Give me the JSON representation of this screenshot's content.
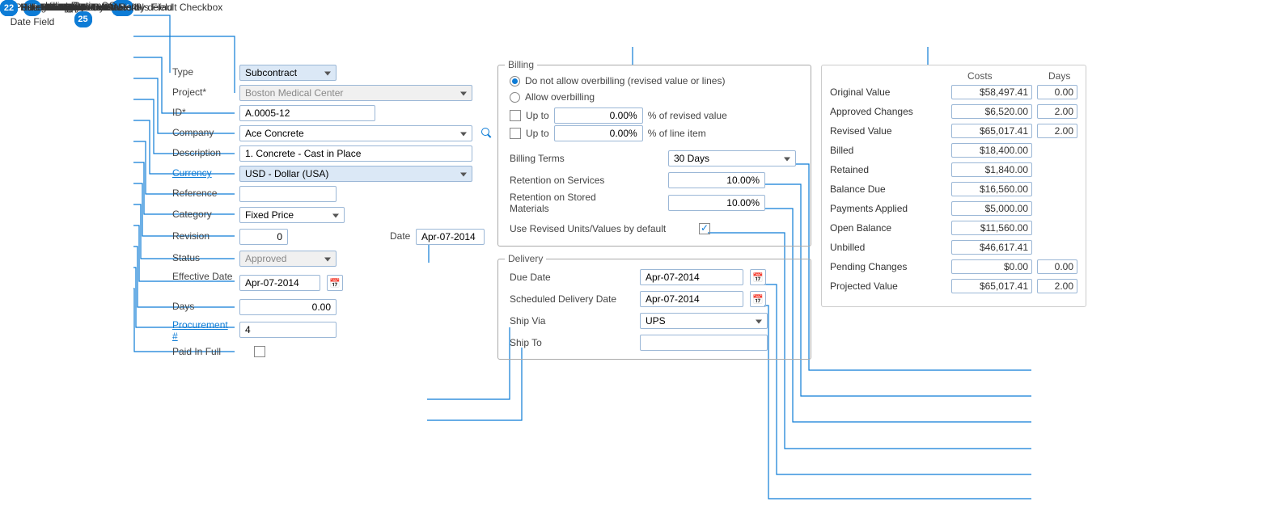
{
  "callouts": {
    "c1": "Type Field",
    "c2": "Project* Field",
    "c3": "ID* Field",
    "c4": "Company Field",
    "c5": "Description Field",
    "c6": "Currency Field",
    "c7": "Reference Field",
    "c8": "Category Field",
    "c9": "Revision Field",
    "c10": "Status Field",
    "c11": "Effective Date Field",
    "c12": "Days Field",
    "c13": "Procurement # Field",
    "c14": "Paid in Full Checkbox",
    "c15": "Date Field",
    "c16": "Overbilling Options Section",
    "c17": "Billing Terms",
    "c18": "Retention on Services Field",
    "c19": "Retention on Stored Materials Field",
    "c20": "Use Revised Units/Values by default Checkbox",
    "c21": "Due Date Field",
    "c22": "Scheduled Delivery Date",
    "c23": "Ship Via Date",
    "c24": "Ship To Field",
    "c25": "Contract Recap Section"
  },
  "labels": {
    "type": "Type",
    "project": "Project*",
    "id": "ID*",
    "company": "Company",
    "description": "Description",
    "currency": "Currency",
    "reference": "Reference",
    "category": "Category",
    "revision": "Revision",
    "date": "Date",
    "status": "Status",
    "effective": "Effective Date",
    "days": "Days",
    "procurement": "Procurement #",
    "paidinfull": "Paid In Full",
    "billing": "Billing",
    "overbill_no": "Do not allow overbilling (revised value or lines)",
    "overbill_yes": "Allow overbilling",
    "upto": "Up to",
    "pct_rev": "% of revised value",
    "pct_line": "% of line item",
    "terms": "Billing Terms",
    "ret_svc": "Retention on Services",
    "ret_mat": "Retention on Stored Materials",
    "use_rev": "Use Revised Units/Values by default",
    "delivery": "Delivery",
    "duedate": "Due Date",
    "sched": "Scheduled Delivery Date",
    "shipvia": "Ship Via",
    "shipto": "Ship To",
    "recap_costs": "Costs",
    "recap_days": "Days"
  },
  "values": {
    "type": "Subcontract",
    "project": "Boston Medical Center",
    "id": "A.0005-12",
    "company": "Ace Concrete",
    "description": "1. Concrete - Cast in Place",
    "currency": "USD - Dollar (USA)",
    "reference": "",
    "category": "Fixed Price",
    "revision": "0",
    "date": "Apr-07-2014",
    "status": "Approved",
    "effective": "Apr-07-2014",
    "days": "0.00",
    "procurement": "4",
    "upto_rev": "0.00%",
    "upto_line": "0.00%",
    "terms": "30 Days",
    "ret_svc": "10.00%",
    "ret_mat": "10.00%",
    "duedate": "Apr-07-2014",
    "sched": "Apr-07-2014",
    "shipvia": "UPS",
    "shipto": ""
  },
  "recap": {
    "rows": [
      {
        "lbl": "Original Value",
        "cost": "$58,497.41",
        "days": "0.00"
      },
      {
        "lbl": "Approved Changes",
        "cost": "$6,520.00",
        "days": "2.00"
      },
      {
        "lbl": "Revised Value",
        "cost": "$65,017.41",
        "days": "2.00"
      },
      {
        "lbl": "Billed",
        "cost": "$18,400.00",
        "days": ""
      },
      {
        "lbl": "Retained",
        "cost": "$1,840.00",
        "days": ""
      },
      {
        "lbl": "Balance Due",
        "cost": "$16,560.00",
        "days": ""
      },
      {
        "lbl": "Payments Applied",
        "cost": "$5,000.00",
        "days": ""
      },
      {
        "lbl": "Open Balance",
        "cost": "$11,560.00",
        "days": ""
      },
      {
        "lbl": "Unbilled",
        "cost": "$46,617.41",
        "days": ""
      },
      {
        "lbl": "Pending Changes",
        "cost": "$0.00",
        "days": "0.00"
      },
      {
        "lbl": "Projected Value",
        "cost": "$65,017.41",
        "days": "2.00"
      }
    ]
  }
}
